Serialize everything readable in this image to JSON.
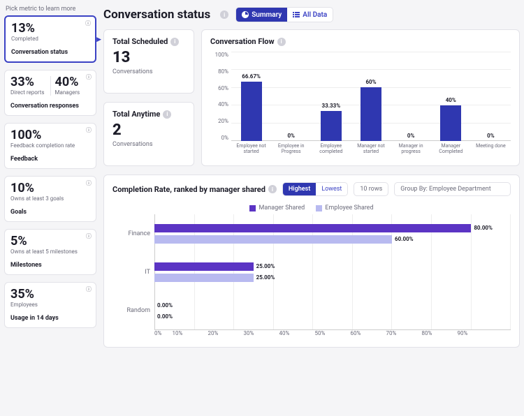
{
  "sidebar": {
    "hint": "Pick metric to learn more",
    "cards": [
      {
        "id": "conv-status",
        "value": "13%",
        "sub": "Completed",
        "name": "Conversation status",
        "selected": true
      },
      {
        "id": "conv-resp",
        "dual": [
          {
            "value": "33%",
            "sub": "Direct reports"
          },
          {
            "value": "40%",
            "sub": "Managers"
          }
        ],
        "name": "Conversation responses"
      },
      {
        "id": "feedback",
        "value": "100%",
        "sub": "Feedback completion rate",
        "name": "Feedback"
      },
      {
        "id": "goals",
        "value": "10%",
        "sub": "Owns at least 3 goals",
        "name": "Goals"
      },
      {
        "id": "milestones",
        "value": "5%",
        "sub": "Owns at least 5 milestones",
        "name": "Milestones"
      },
      {
        "id": "usage",
        "value": "35%",
        "sub": "Employees",
        "name": "Usage in 14 days"
      }
    ]
  },
  "header": {
    "title": "Conversation status",
    "toggle": {
      "summary": "Summary",
      "all": "All Data"
    }
  },
  "stats": {
    "scheduled": {
      "title": "Total Scheduled",
      "value": "13",
      "sub": "Conversations"
    },
    "anytime": {
      "title": "Total Anytime",
      "value": "2",
      "sub": "Conversations"
    }
  },
  "flow_panel": {
    "title": "Conversation Flow"
  },
  "completion_panel": {
    "title": "Completion Rate, ranked by manager shared",
    "highest": "Highest",
    "lowest": "Lowest",
    "rows_select": "10 rows",
    "group_select": "Group By: Employee Department",
    "legend": {
      "a": "Manager Shared",
      "b": "Employee Shared"
    }
  },
  "chart_data": [
    {
      "id": "conversation_flow",
      "type": "bar",
      "title": "Conversation Flow",
      "ylabel": "%",
      "ylim": [
        0,
        100
      ],
      "yticks": [
        0,
        20,
        40,
        60,
        80,
        100
      ],
      "categories": [
        "Employee not started",
        "Employee in Progress",
        "Employee completed",
        "Manager not started",
        "Manager in progress",
        "Manager Completed",
        "Meeting done"
      ],
      "values": [
        66.67,
        0,
        33.33,
        60,
        0,
        40,
        0
      ],
      "value_labels": [
        "66.67%",
        "0%",
        "33.33%",
        "60%",
        "0%",
        "40%",
        "0%"
      ]
    },
    {
      "id": "completion_rate",
      "type": "bar",
      "orientation": "horizontal",
      "title": "Completion Rate, ranked by manager shared",
      "xlabel": "%",
      "xlim": [
        0,
        90
      ],
      "xticks": [
        0,
        10,
        20,
        30,
        40,
        50,
        60,
        70,
        80,
        90
      ],
      "categories": [
        "Finance",
        "IT",
        "Random"
      ],
      "series": [
        {
          "name": "Manager Shared",
          "values": [
            80.0,
            25.0,
            0.0
          ]
        },
        {
          "name": "Employee Shared",
          "values": [
            60.0,
            25.0,
            0.0
          ]
        }
      ],
      "value_labels": [
        [
          "80.00%",
          "25.00%",
          "0.00%"
        ],
        [
          "60.00%",
          "25.00%",
          "0.00%"
        ]
      ]
    }
  ]
}
